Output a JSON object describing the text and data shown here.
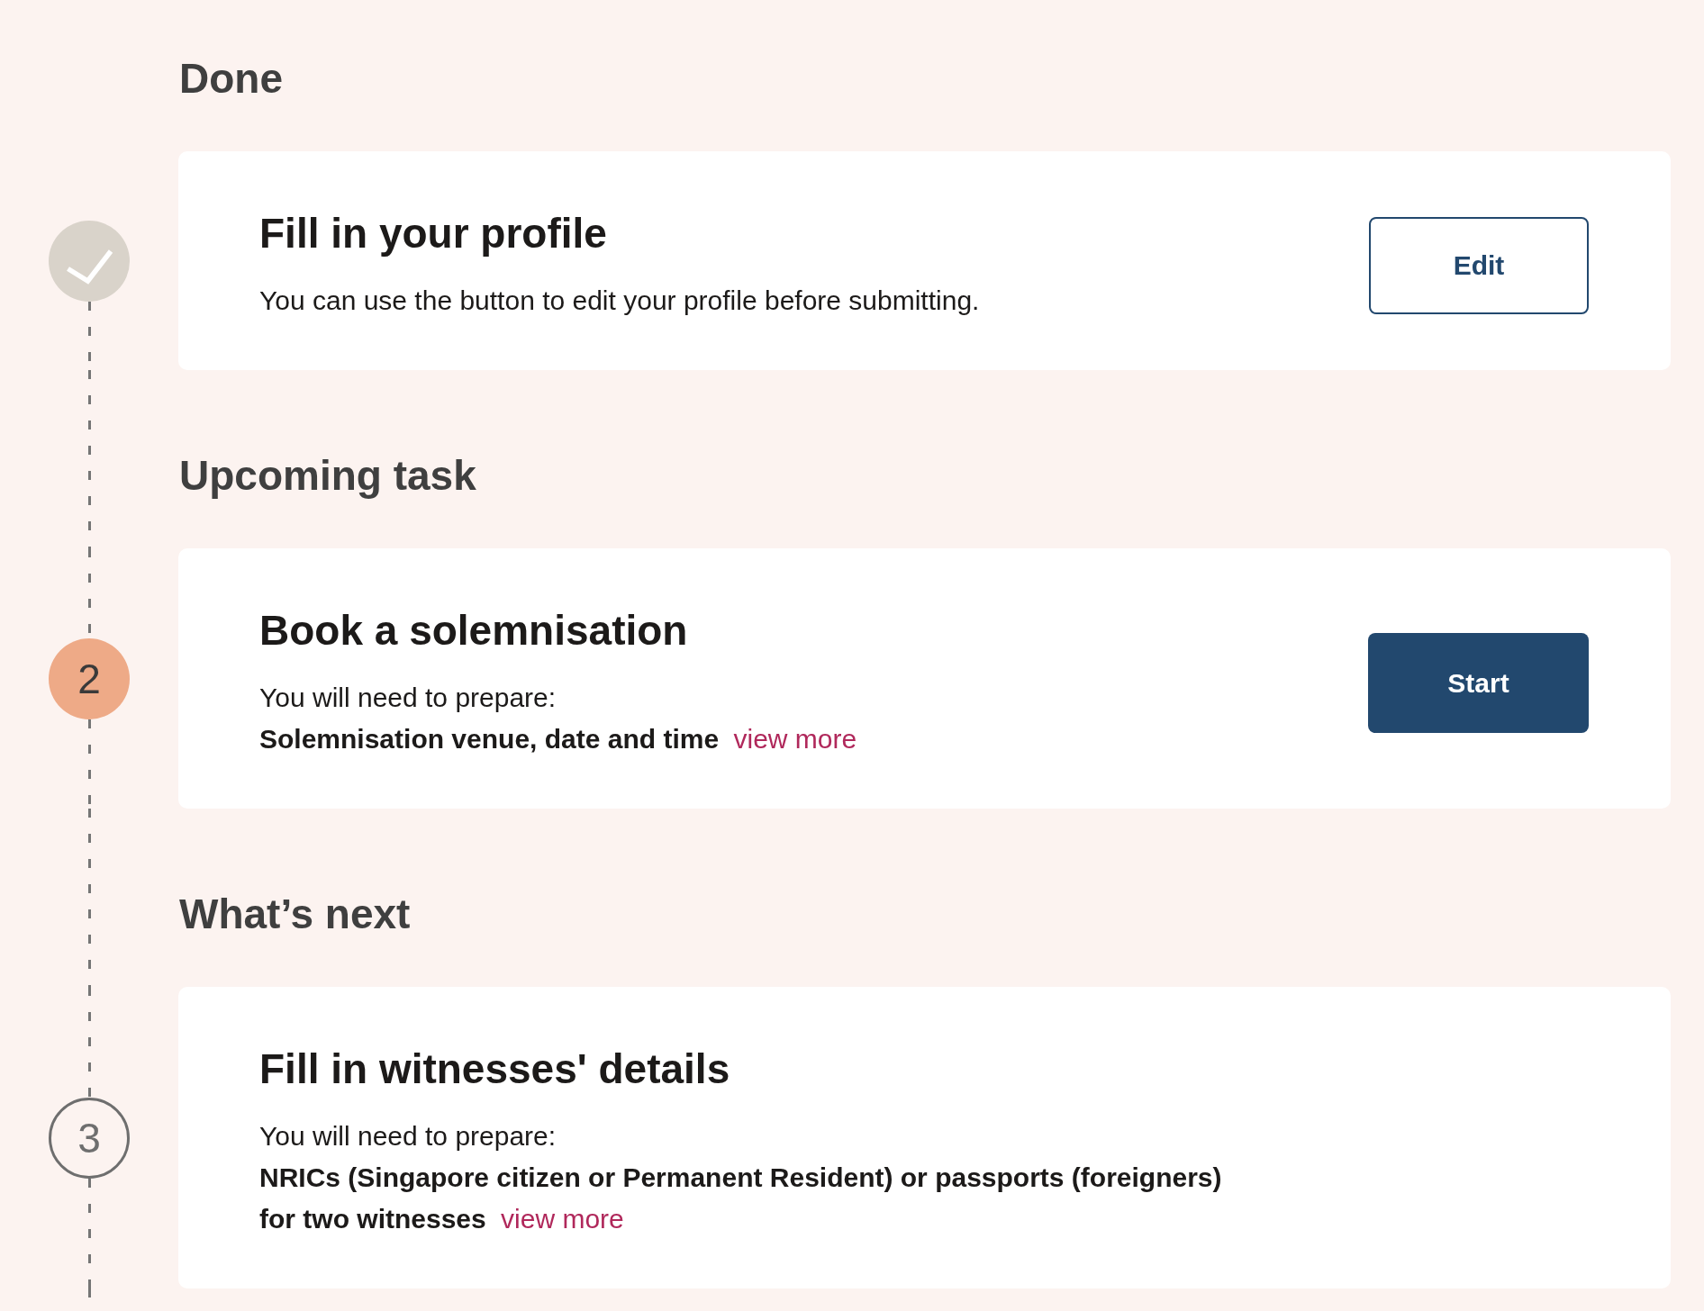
{
  "sections": [
    {
      "heading": "Done",
      "step": {
        "kind": "done"
      },
      "card": {
        "title": "Fill in your profile",
        "description": "You can use the button to edit your profile before submitting.",
        "button": {
          "label": "Edit",
          "kind": "outline"
        }
      }
    },
    {
      "heading": "Upcoming task",
      "step": {
        "kind": "current",
        "number": "2"
      },
      "card": {
        "title": "Book a solemnisation",
        "intro": "You will need to prepare:",
        "requirements": "Solemnisation venue, date and time",
        "link": "view more",
        "button": {
          "label": "Start",
          "kind": "filled"
        }
      }
    },
    {
      "heading": "What’s next",
      "step": {
        "kind": "upcoming",
        "number": "3"
      },
      "card": {
        "title": "Fill in witnesses' details",
        "intro": "You will need to prepare:",
        "requirements": "NRICs (Singapore citizen or Permanent Resident) or passports (foreigners) for two witnesses",
        "link": "view more"
      }
    }
  ]
}
